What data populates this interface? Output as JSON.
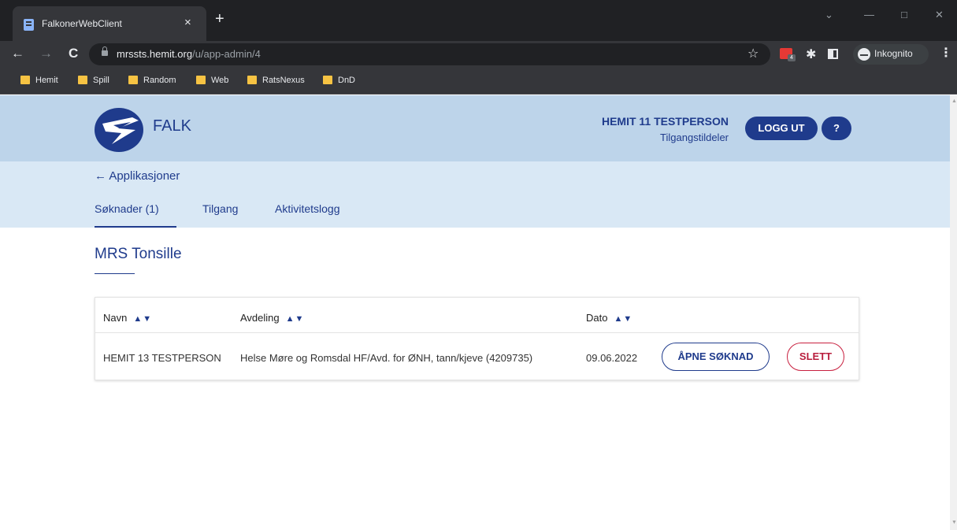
{
  "browser": {
    "tab_title": "FalkonerWebClient",
    "tab_close": "×",
    "new_tab": "+",
    "url_host": "mrssts.hemit.org",
    "url_path": "/u/app-admin/4",
    "incognito_label": "Inkognito",
    "extension_badge": "4",
    "bookmarks": [
      "Hemit",
      "Spill",
      "Random",
      "Web",
      "RatsNexus",
      "DnD"
    ]
  },
  "header": {
    "brand": "FALK",
    "user_name": "HEMIT 11 TESTPERSON",
    "user_role": "Tilgangstildeler",
    "logout_label": "LOGG UT",
    "help_label": "?"
  },
  "subnav": {
    "back_label": "← Applikasjoner",
    "tabs": [
      {
        "label": "Søknader (1)",
        "active": true
      },
      {
        "label": "Tilgang",
        "active": false
      },
      {
        "label": "Aktivitetslogg",
        "active": false
      }
    ]
  },
  "main": {
    "app_title": "MRS Tonsille",
    "table": {
      "columns": [
        "Navn",
        "Avdeling",
        "Dato"
      ],
      "sort_icon": "▲▼",
      "rows": [
        {
          "navn": "HEMIT 13 TESTPERSON",
          "avdeling": "Helse Møre og Romsdal HF/Avd. for ØNH, tann/kjeve (4209735)",
          "dato": "09.06.2022",
          "open_label": "ÅPNE SØKNAD",
          "delete_label": "SLETT"
        }
      ]
    }
  },
  "colors": {
    "primary": "#1f3b8c",
    "header_bg": "#bdd4ea",
    "subheader_bg": "#d9e8f5",
    "danger": "#b81e3d"
  }
}
